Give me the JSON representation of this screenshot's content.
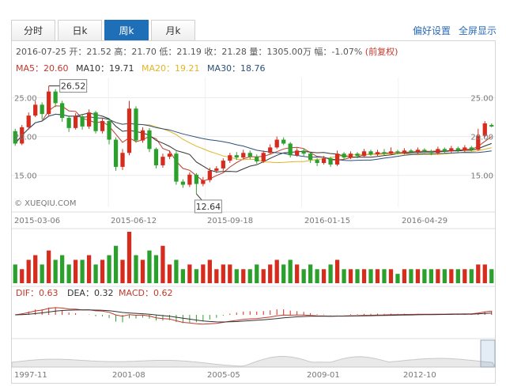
{
  "tabs": [
    {
      "label": "分时",
      "active": false
    },
    {
      "label": "日k",
      "active": false
    },
    {
      "label": "周k",
      "active": true
    },
    {
      "label": "月k",
      "active": false
    }
  ],
  "links": {
    "settings": "偏好设置",
    "fullscreen": "全屏显示"
  },
  "info": {
    "text": "2016-07-25 开：21.52 高：21.70 低：21.19 收：21.28 量：1305.00万 幅：-1.07%",
    "fuquan": "(前复权)"
  },
  "ma": [
    {
      "label": "MA5：20.60",
      "color": "#c0392b"
    },
    {
      "label": "MA10：19.71",
      "color": "#333333"
    },
    {
      "label": "MA20：19.21",
      "color": "#e0b52a"
    },
    {
      "label": "MA30：18.76",
      "color": "#2c4f7a"
    }
  ],
  "macd_header": [
    {
      "label": "DIF：0.63",
      "color": "#c0392b"
    },
    {
      "label": "DEA：0.32",
      "color": "#333333"
    },
    {
      "label": "MACD：0.62",
      "color": "#c0392b"
    }
  ],
  "watermark": "© XUEQIU.COM",
  "colors": {
    "up": "#d62c1e",
    "down": "#2ca02c",
    "accent": "#1f6fb8"
  },
  "chart_data": {
    "type": "candlestick",
    "title": "周k",
    "ylim": [
      10.9,
      27.6
    ],
    "y_ticks": [
      "25.00",
      "20.00",
      "15.00"
    ],
    "x_ticks": [
      "2015-03-06",
      "2015-06-12",
      "2015-09-18",
      "2016-01-15",
      "2016-04-29"
    ],
    "annotations": [
      {
        "label": "26.52",
        "value": 26.52,
        "kind": "max"
      },
      {
        "label": "12.64",
        "value": 12.64,
        "kind": "min"
      }
    ],
    "candles": [
      [
        20.7,
        19.1,
        21.0,
        18.8
      ],
      [
        19.1,
        21.2,
        21.5,
        18.9
      ],
      [
        21.2,
        22.7,
        23.1,
        20.9
      ],
      [
        22.7,
        24.1,
        24.6,
        22.5
      ],
      [
        24.1,
        22.9,
        24.4,
        22.2
      ],
      [
        22.9,
        25.8,
        26.5,
        22.7
      ],
      [
        25.8,
        24.3,
        26.1,
        23.8
      ],
      [
        24.3,
        22.4,
        24.6,
        21.9
      ],
      [
        22.4,
        21.1,
        22.7,
        20.6
      ],
      [
        21.1,
        22.6,
        23.0,
        20.9
      ],
      [
        22.6,
        21.3,
        22.9,
        20.9
      ],
      [
        21.3,
        23.1,
        23.5,
        21.0
      ],
      [
        23.1,
        20.7,
        23.3,
        20.4
      ],
      [
        20.7,
        22.0,
        22.4,
        20.4
      ],
      [
        22.0,
        19.6,
        22.3,
        19.0
      ],
      [
        19.6,
        16.1,
        19.9,
        15.6
      ],
      [
        16.1,
        17.9,
        18.4,
        15.7
      ],
      [
        17.9,
        23.6,
        24.6,
        17.6
      ],
      [
        23.6,
        19.5,
        23.9,
        19.2
      ],
      [
        19.5,
        20.8,
        21.2,
        19.2
      ],
      [
        20.8,
        18.4,
        21.1,
        18.0
      ],
      [
        18.4,
        16.3,
        18.6,
        15.9
      ],
      [
        16.3,
        17.4,
        17.8,
        16.0
      ],
      [
        17.4,
        17.8,
        18.2,
        17.1
      ],
      [
        17.8,
        14.2,
        18.1,
        13.8
      ],
      [
        14.2,
        13.8,
        14.5,
        13.4
      ],
      [
        13.8,
        15.1,
        15.4,
        13.5
      ],
      [
        15.1,
        13.9,
        15.3,
        12.64
      ],
      [
        13.9,
        14.4,
        14.8,
        13.6
      ],
      [
        14.4,
        15.6,
        16.0,
        14.1
      ],
      [
        15.6,
        15.9,
        16.2,
        15.3
      ],
      [
        15.9,
        16.9,
        17.2,
        15.6
      ],
      [
        16.9,
        17.6,
        17.9,
        16.6
      ],
      [
        17.6,
        17.3,
        18.0,
        17.0
      ],
      [
        17.3,
        17.9,
        18.3,
        17.1
      ],
      [
        17.9,
        17.4,
        18.2,
        17.1
      ],
      [
        17.4,
        16.8,
        17.7,
        16.5
      ],
      [
        16.8,
        17.9,
        18.2,
        16.6
      ],
      [
        17.9,
        18.6,
        19.0,
        17.7
      ],
      [
        18.6,
        19.6,
        20.0,
        18.4
      ],
      [
        19.6,
        19.1,
        19.9,
        18.9
      ],
      [
        19.1,
        17.6,
        19.3,
        17.3
      ],
      [
        17.6,
        18.2,
        18.5,
        17.4
      ],
      [
        18.2,
        17.8,
        18.5,
        17.5
      ],
      [
        17.8,
        17.0,
        18.0,
        16.6
      ],
      [
        17.0,
        16.6,
        17.2,
        16.2
      ],
      [
        16.6,
        17.2,
        17.5,
        16.4
      ],
      [
        17.2,
        16.4,
        17.4,
        16.1
      ],
      [
        16.4,
        17.8,
        18.2,
        16.2
      ],
      [
        17.8,
        17.3,
        18.0,
        17.0
      ],
      [
        17.3,
        17.8,
        18.1,
        17.1
      ],
      [
        17.8,
        17.5,
        18.0,
        17.2
      ],
      [
        17.5,
        18.1,
        18.4,
        17.3
      ],
      [
        18.1,
        17.7,
        18.3,
        17.5
      ],
      [
        17.7,
        18.0,
        18.3,
        17.5
      ],
      [
        18.0,
        17.8,
        18.4,
        17.6
      ],
      [
        17.8,
        18.1,
        18.6,
        17.6
      ],
      [
        18.1,
        17.9,
        18.3,
        17.7
      ],
      [
        17.9,
        18.2,
        18.5,
        17.7
      ],
      [
        18.2,
        18.0,
        18.4,
        17.8
      ],
      [
        18.0,
        18.3,
        18.6,
        17.8
      ],
      [
        18.3,
        18.1,
        18.5,
        17.9
      ],
      [
        18.1,
        17.9,
        18.3,
        17.6
      ],
      [
        17.9,
        18.4,
        18.7,
        17.7
      ],
      [
        18.4,
        18.1,
        18.6,
        17.9
      ],
      [
        18.1,
        18.5,
        18.8,
        17.9
      ],
      [
        18.5,
        18.2,
        18.7,
        18.0
      ],
      [
        18.2,
        18.6,
        18.9,
        18.0
      ],
      [
        18.6,
        18.3,
        18.8,
        18.1
      ],
      [
        18.3,
        20.1,
        21.0,
        18.2
      ],
      [
        20.1,
        21.7,
        22.0,
        19.9
      ],
      [
        21.5,
        21.3,
        21.7,
        21.2
      ]
    ],
    "volume": [
      4,
      3,
      5,
      6,
      4,
      7,
      5,
      6,
      4,
      5,
      5,
      6,
      4,
      5,
      6,
      8,
      5,
      11,
      6,
      5,
      7,
      6,
      8,
      4,
      5,
      3,
      4,
      3,
      4,
      5,
      3,
      4,
      4,
      3,
      3,
      3,
      4,
      3,
      4,
      5,
      4,
      5,
      4,
      3,
      4,
      3,
      3,
      4,
      5,
      3,
      3,
      3,
      3,
      3,
      3,
      3,
      3,
      2,
      3,
      3,
      3,
      3,
      3,
      3,
      3,
      3,
      3,
      3,
      3,
      4,
      4,
      3
    ],
    "x_ticks_overview": [
      "1997-11",
      "2001-08",
      "2005-05",
      "2009-01",
      "2012-10"
    ]
  }
}
